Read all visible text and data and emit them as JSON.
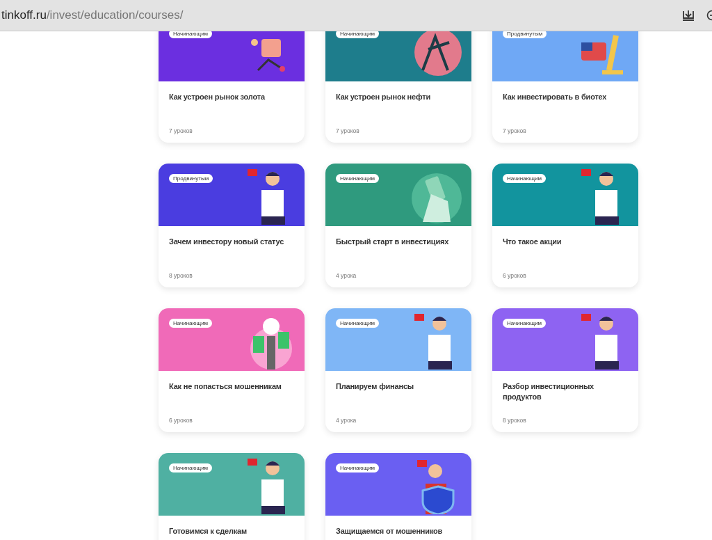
{
  "address_bar": {
    "domain": "tinkoff.ru",
    "path": "/invest/education/courses/"
  },
  "courses": [
    {
      "badge": "Начинающим",
      "title": "Как устроен рынок золота",
      "lessons": "7 уроков",
      "color": "#6b2fe0",
      "kind": "cart"
    },
    {
      "badge": "Начинающим",
      "title": "Как устроен рынок нефти",
      "lessons": "7 уроков",
      "color": "#1e7d8c",
      "kind": "oil"
    },
    {
      "badge": "Продвинутым",
      "title": "Как инвестировать в биотех",
      "lessons": "7 уроков",
      "color": "#6fa8f5",
      "kind": "micro"
    },
    {
      "badge": "Продвинутым",
      "title": "Зачем инвестору новый статус",
      "lessons": "8 уроков",
      "color": "#4a3de0",
      "kind": "person"
    },
    {
      "badge": "Начинающим",
      "title": "Быстрый старт в инвестициях",
      "lessons": "4 урока",
      "color": "#2f9a7e",
      "kind": "phone"
    },
    {
      "badge": "Начинающим",
      "title": "Что такое акции",
      "lessons": "6 уроков",
      "color": "#12949e",
      "kind": "person"
    },
    {
      "badge": "Начинающим",
      "title": "Как не попасться мошенникам",
      "lessons": "6 уроков",
      "color": "#f06ab8",
      "kind": "hand"
    },
    {
      "badge": "Начинающим",
      "title": "Планируем финансы",
      "lessons": "4 урока",
      "color": "#7fb6f6",
      "kind": "person"
    },
    {
      "badge": "Начинающим",
      "title": "Разбор инвестиционных продуктов",
      "lessons": "8 уроков",
      "color": "#8e63f2",
      "kind": "person"
    },
    {
      "badge": "Начинающим",
      "title": "Готовимся к сделкам",
      "color": "#4fb0a2",
      "kind": "person"
    },
    {
      "badge": "Начинающим",
      "title": "Защищаемся от мошенников",
      "color": "#6a5ff2",
      "kind": "shield"
    }
  ]
}
